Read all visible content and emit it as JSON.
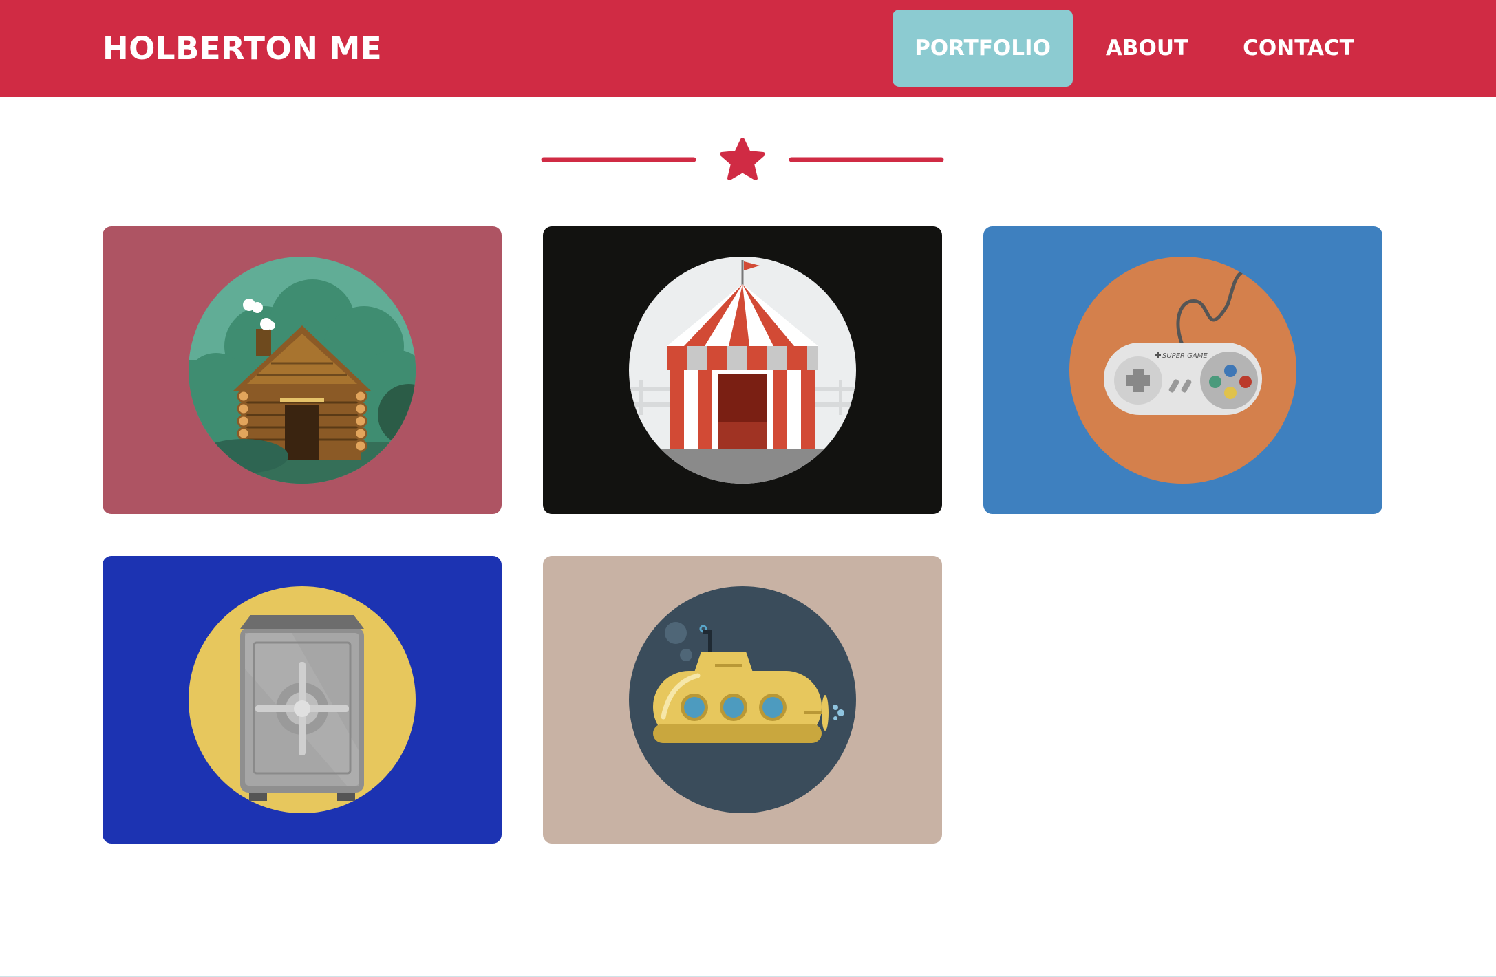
{
  "brand": "HOLBERTON ME",
  "nav": [
    {
      "label": "PORTFOLIO",
      "active": true
    },
    {
      "label": "ABOUT",
      "active": false
    },
    {
      "label": "CONTACT",
      "active": false
    }
  ],
  "colors": {
    "primary": "#d02b44",
    "nav_active_bg": "#8ccbd1"
  },
  "portfolio": [
    {
      "icon": "log-cabin-icon",
      "background": "#ae5463"
    },
    {
      "icon": "circus-tent-icon",
      "background": "#121210"
    },
    {
      "icon": "game-controller-icon",
      "background": "#3e80bf",
      "label": "SUPER GAME"
    },
    {
      "icon": "safe-icon",
      "background": "#1c33b2"
    },
    {
      "icon": "submarine-icon",
      "background": "#c8b2a4"
    }
  ]
}
